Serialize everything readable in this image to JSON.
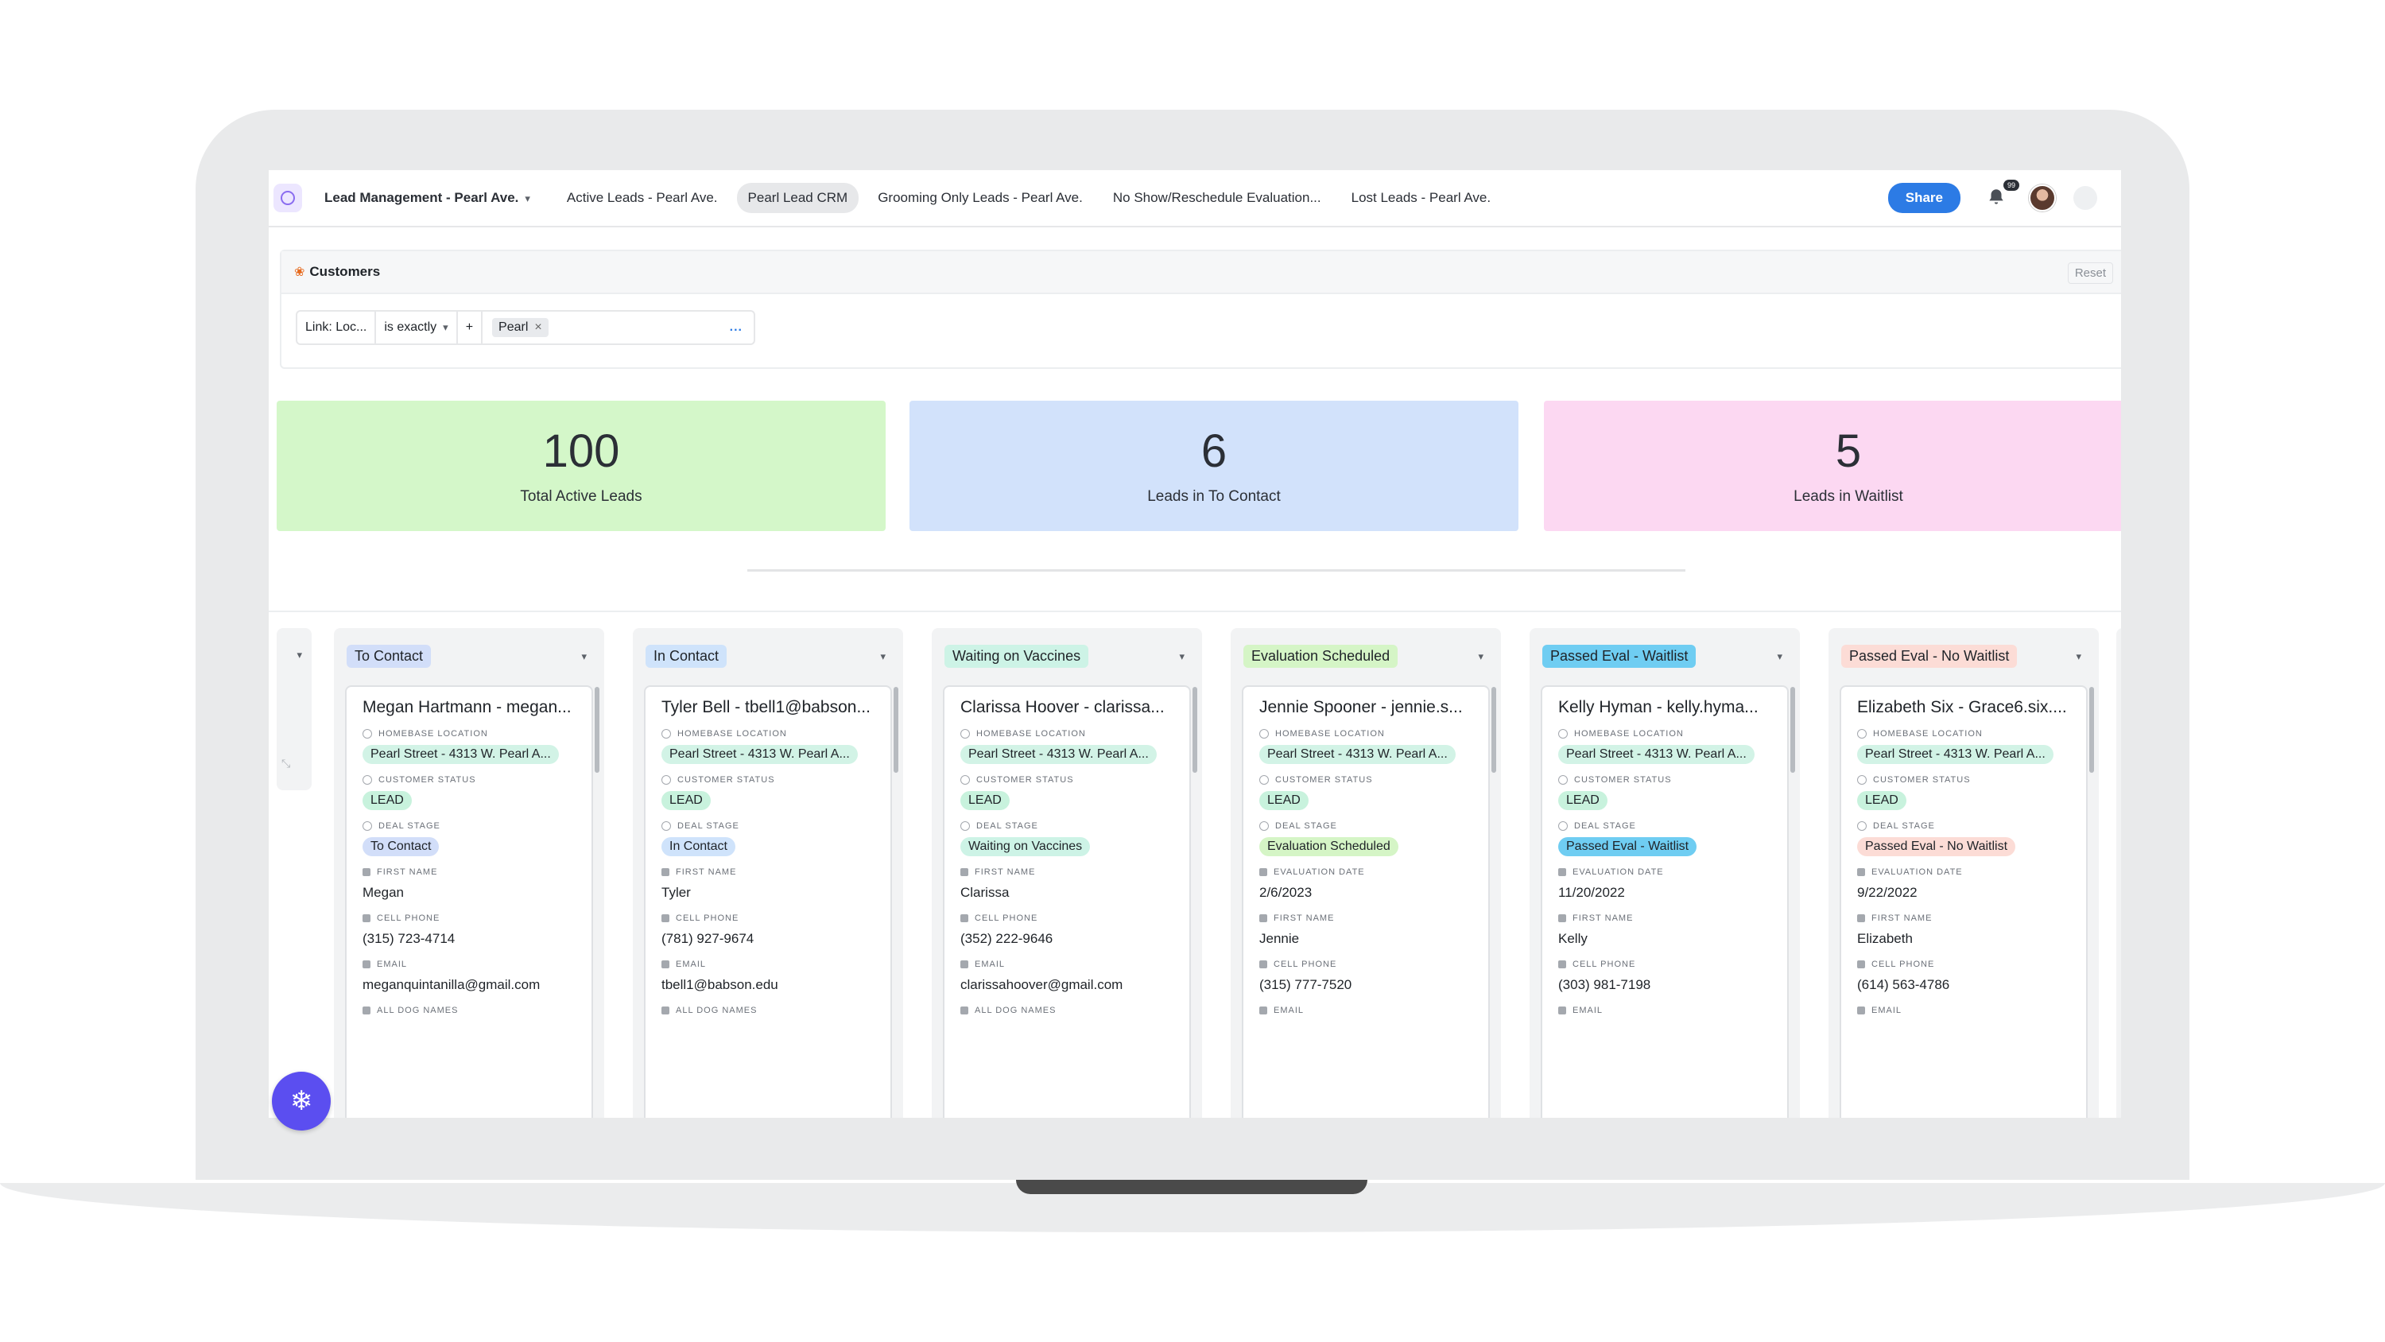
{
  "colors": {
    "green_card": "#d4f7c9",
    "blue_card": "#d2e2fb",
    "pink_card": "#fcd8f2",
    "share": "#2c7be5",
    "fab": "#5b4ef0",
    "location_pill": "#d2f3e6",
    "lead_pill": "#c8f2dd"
  },
  "nav": {
    "tabs": [
      {
        "label": "Lead Management - Pearl Ave."
      },
      {
        "label": "Active Leads - Pearl Ave."
      },
      {
        "label": "Pearl Lead CRM"
      },
      {
        "label": "Grooming Only Leads - Pearl Ave."
      },
      {
        "label": "No Show/Reschedule Evaluation..."
      },
      {
        "label": "Lost Leads - Pearl Ave."
      }
    ],
    "share_label": "Share",
    "notif_count": "99"
  },
  "customers_panel": {
    "title": "Customers",
    "reset_label": "Reset",
    "filter": {
      "field": "Link: Loc...",
      "operator": "is exactly",
      "add": "+",
      "value": "Pearl",
      "remove": "×",
      "more": "..."
    }
  },
  "stats": [
    {
      "value": "100",
      "label": "Total Active Leads"
    },
    {
      "value": "6",
      "label": "Leads in To Contact"
    },
    {
      "value": "5",
      "label": "Leads in Waitlist"
    }
  ],
  "labels": {
    "homebase": "HOMEBASE LOCATION",
    "status": "CUSTOMER STATUS",
    "deal": "DEAL STAGE",
    "first_name": "FIRST NAME",
    "cell": "CELL PHONE",
    "email": "EMAIL",
    "dogs": "ALL DOG NAMES",
    "eval_date": "EVALUATION DATE"
  },
  "columns": [
    {
      "title": "To Contact",
      "color": "#d2def9",
      "card": {
        "title": "Megan Hartmann - megan...",
        "location": "Pearl Street - 4313 W. Pearl A...",
        "status": "LEAD",
        "stage": "To Contact",
        "first_name": "Megan",
        "cell": "(315) 723-4714",
        "email": "meganquintanilla@gmail.com"
      }
    },
    {
      "title": "In Contact",
      "color": "#cfe3fb",
      "card": {
        "title": "Tyler Bell - tbell1@babson...",
        "location": "Pearl Street - 4313 W. Pearl A...",
        "status": "LEAD",
        "stage": "In Contact",
        "first_name": "Tyler",
        "cell": "(781) 927-9674",
        "email": "tbell1@babson.edu"
      }
    },
    {
      "title": "Waiting on Vaccines",
      "color": "#cdf3e6",
      "card": {
        "title": "Clarissa Hoover - clarissa...",
        "location": "Pearl Street - 4313 W. Pearl A...",
        "status": "LEAD",
        "stage": "Waiting on Vaccines",
        "first_name": "Clarissa",
        "cell": "(352) 222-9646",
        "email": "clarissahoover@gmail.com"
      }
    },
    {
      "title": "Evaluation Scheduled",
      "color": "#d5f5c6",
      "card": {
        "title": "Jennie Spooner - jennie.s...",
        "location": "Pearl Street - 4313 W. Pearl A...",
        "status": "LEAD",
        "stage": "Evaluation Scheduled",
        "eval_date": "2/6/2023",
        "first_name": "Jennie",
        "cell": "(315) 777-7520"
      }
    },
    {
      "title": "Passed Eval - Waitlist",
      "color": "#6fcdf2",
      "card": {
        "title": "Kelly Hyman - kelly.hyma...",
        "location": "Pearl Street - 4313 W. Pearl A...",
        "status": "LEAD",
        "stage": "Passed Eval - Waitlist",
        "eval_date": "11/20/2022",
        "first_name": "Kelly",
        "cell": "(303) 981-7198"
      }
    },
    {
      "title": "Passed Eval - No Waitlist",
      "color": "#fcdcd6",
      "card": {
        "title": "Elizabeth Six - Grace6.six....",
        "location": "Pearl Street - 4313 W. Pearl A...",
        "status": "LEAD",
        "stage": "Passed Eval - No Waitlist",
        "eval_date": "9/22/2022",
        "first_name": "Elizabeth",
        "cell": "(614) 563-4786"
      }
    }
  ]
}
